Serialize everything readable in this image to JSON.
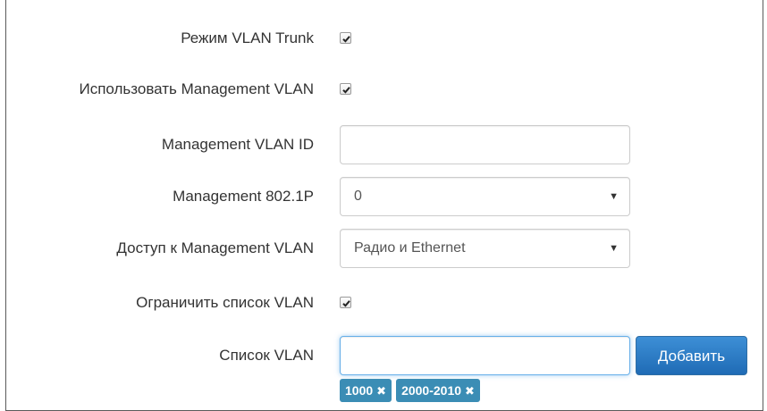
{
  "form": {
    "trunk_mode": {
      "label": "Режим VLAN Trunk",
      "checked": true
    },
    "use_mgmt_vlan": {
      "label": "Использовать Management VLAN",
      "checked": true
    },
    "mgmt_vlan_id": {
      "label": "Management VLAN ID",
      "value": ""
    },
    "mgmt_8021p": {
      "label": "Management 802.1P",
      "value": "0"
    },
    "mgmt_access": {
      "label": "Доступ к Management VLAN",
      "value": "Радио и Ethernet"
    },
    "restrict_vlan_list": {
      "label": "Ограничить список VLAN",
      "checked": true
    },
    "vlan_list": {
      "label": "Список VLAN",
      "value": "",
      "add_label": "Добавить",
      "tags": [
        "1000",
        "2000-2010"
      ]
    }
  },
  "colors": {
    "primary": "#1f6bb5",
    "tag": "#3b8db5",
    "focus": "#66afe9"
  }
}
